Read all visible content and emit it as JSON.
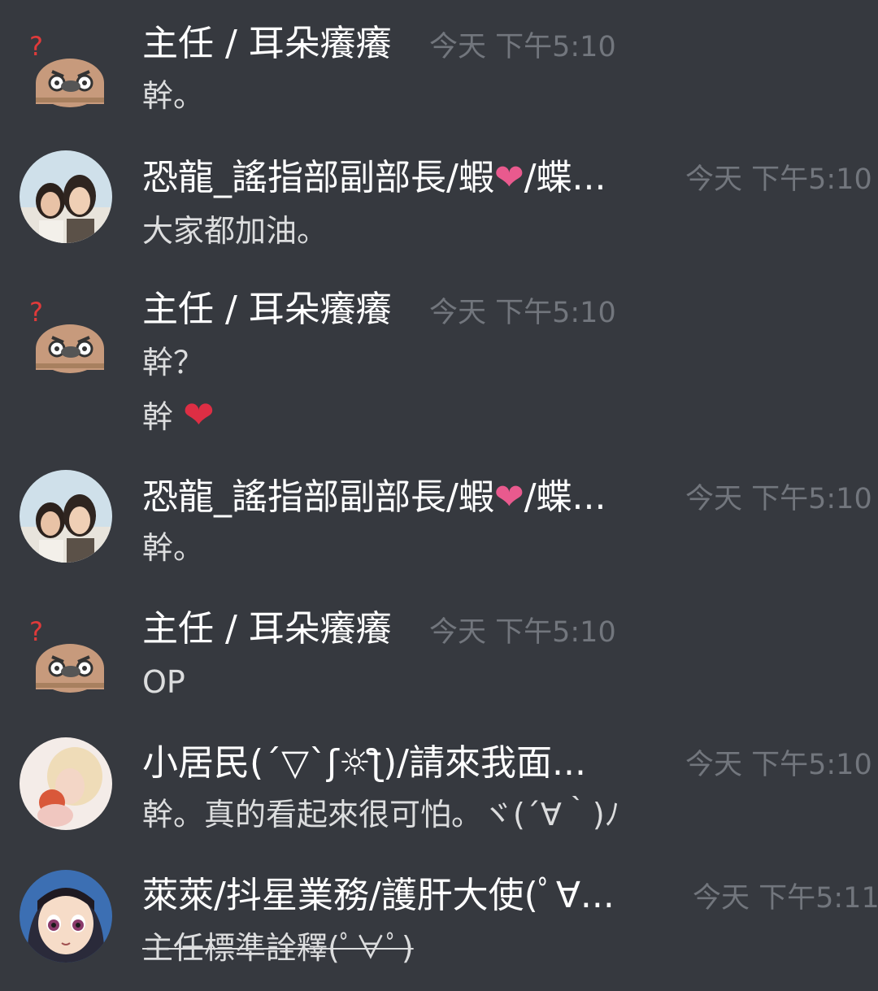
{
  "messages": [
    {
      "avatar": "bird-question-avatar",
      "author": "主任 / 耳朵癢癢",
      "timestamp": "今天 下午5:10",
      "lines": [
        "幹。"
      ]
    },
    {
      "avatar": "two-women-photo-avatar",
      "author_prefix": "恐龍_謠指部副部長/蝦",
      "author_heart": "❤",
      "author_suffix": "/蝶...",
      "timestamp": "今天 下午5:10",
      "lines": [
        "大家都加油。"
      ]
    },
    {
      "avatar": "bird-question-avatar",
      "author": "主任 / 耳朵癢癢",
      "timestamp": "今天 下午5:10",
      "lines": [
        "幹？",
        "幹"
      ],
      "heart": "❤"
    },
    {
      "avatar": "two-women-photo-avatar",
      "author_prefix": "恐龍_謠指部副部長/蝦",
      "author_heart": "❤",
      "author_suffix": "/蝶...",
      "timestamp": "今天 下午5:10",
      "lines": [
        "幹。"
      ]
    },
    {
      "avatar": "bird-question-avatar",
      "author": "主任 / 耳朵癢癢",
      "timestamp": "今天 下午5:10",
      "lines": [
        "OP"
      ]
    },
    {
      "avatar": "blonde-girl-photo-avatar",
      "author": "小居民(´▽`ʃ☼ƪ)/請來我面...",
      "timestamp": "今天 下午5:10",
      "lines": [
        "幹。真的看起來很可怕。ヾ(´∀｀)ﾉ"
      ]
    },
    {
      "avatar": "anime-character-avatar",
      "author": "萊萊/抖星業務/護肝大使(ﾟ∀...",
      "timestamp": "今天 下午5:11",
      "lines": [
        "主任標準詮釋(ﾟ∀ﾟ)"
      ],
      "strikethrough": true
    }
  ],
  "colors": {
    "background": "#36393f",
    "author": "#ffffff",
    "timestamp": "#72767d",
    "text": "#dcddde",
    "pink_heart": "#e95a8e",
    "red_heart": "#dd2e44"
  }
}
